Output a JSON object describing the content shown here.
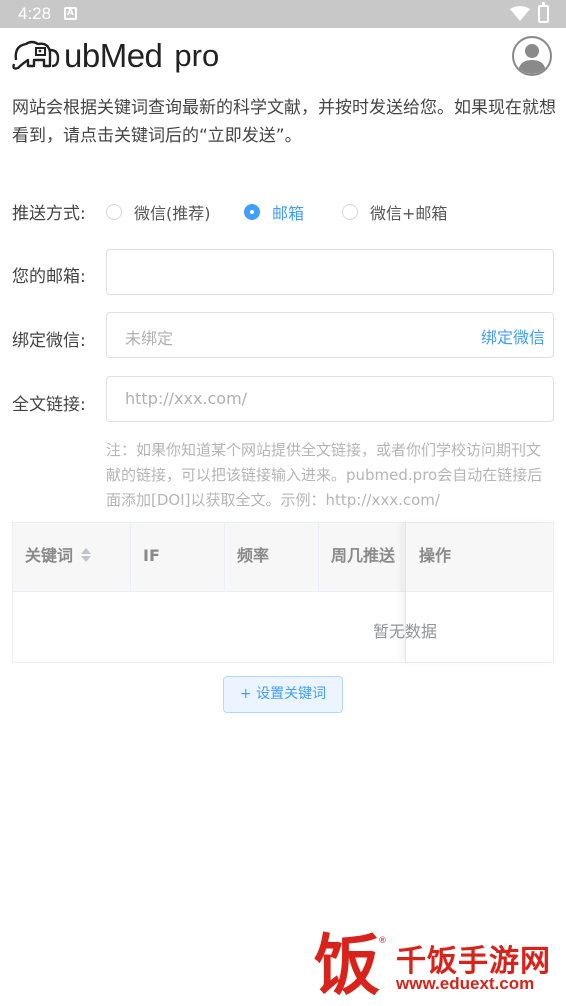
{
  "status_bar": {
    "time": "4:28",
    "notification_glyph": "A"
  },
  "header": {
    "logo_text": "ubMed",
    "logo_suffix": "pro",
    "logo_icon": "elephant-logo-icon",
    "avatar_icon": "user-avatar-icon"
  },
  "intro": "网站会根据关键词查询最新的科学文献，并按时发送给您。如果现在就想看到，请点击关键词后的“立即发送”。",
  "push_method": {
    "label": "推送方式:",
    "options": [
      {
        "label": "微信(推荐)",
        "checked": false
      },
      {
        "label": "邮箱",
        "checked": true
      },
      {
        "label": "微信+邮箱",
        "checked": false
      }
    ]
  },
  "email": {
    "label": "您的邮箱:",
    "value": "",
    "placeholder": ""
  },
  "wechat": {
    "label": "绑定微信:",
    "status": "未绑定",
    "bind_link": "绑定微信"
  },
  "fulltext": {
    "label": "全文链接:",
    "placeholder": "http://xxx.com/",
    "note": "注：如果你知道某个网站提供全文链接，或者你们学校访问期刊文献的链接，可以把该链接输入进来。pubmed.pro会自动在链接后面添加[DOI]以获取全文。示例：http://xxx.com/"
  },
  "table": {
    "columns": [
      "关键词",
      "IF",
      "频率",
      "周几推送",
      "操作"
    ],
    "empty_text": "暂无数据"
  },
  "add_keyword_button": "+ 设置关键词",
  "watermark": {
    "glyph": "饭",
    "mark": "®",
    "name": "千饭手游网",
    "url": "www.eduext.com"
  },
  "colors": {
    "accent": "#409eff",
    "status_bar": "#c8c8c8",
    "watermark": "#d9231a"
  }
}
